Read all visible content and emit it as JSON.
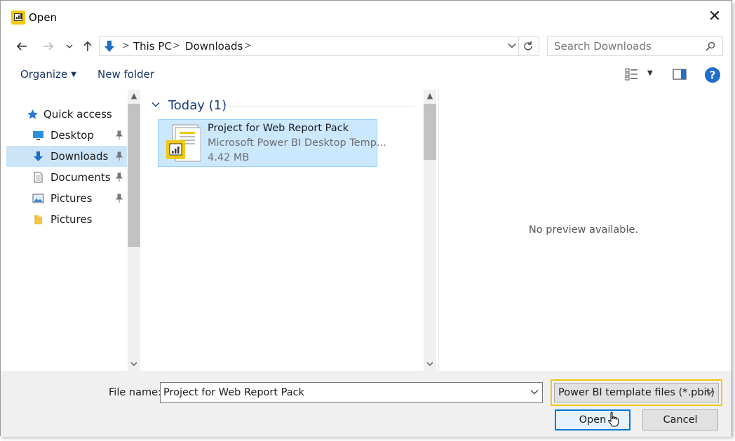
{
  "window": {
    "title": "Open",
    "close_icon": "close-icon"
  },
  "colors": {
    "accent": "#0078d7",
    "highlight": "#f2c811",
    "selection": "#cce8ff",
    "header_blue": "#1a3c7a"
  },
  "address_bar": {
    "crumbs": [
      "This PC",
      "Downloads"
    ],
    "separator": ">"
  },
  "search": {
    "placeholder": "Search Downloads"
  },
  "toolbar": {
    "organize_label": "Organize",
    "new_folder_label": "New folder",
    "help_label": "?"
  },
  "nav": {
    "items": [
      {
        "label": "Quick access",
        "icon": "star-icon",
        "pinned": false,
        "selected": false
      },
      {
        "label": "Desktop",
        "icon": "desktop-icon",
        "pinned": true,
        "selected": false
      },
      {
        "label": "Downloads",
        "icon": "download-icon",
        "pinned": true,
        "selected": true
      },
      {
        "label": "Documents",
        "icon": "document-icon",
        "pinned": true,
        "selected": false
      },
      {
        "label": "Pictures",
        "icon": "pictures-icon",
        "pinned": true,
        "selected": false
      },
      {
        "label": "Pictures",
        "icon": "folder-icon",
        "pinned": false,
        "selected": false
      }
    ]
  },
  "files": {
    "group_label": "Today (1)",
    "items": [
      {
        "name": "Project for Web Report Pack",
        "type": "Microsoft Power BI Desktop Temp...",
        "size": "4.42 MB"
      }
    ]
  },
  "preview": {
    "message": "No preview available."
  },
  "bottom": {
    "file_name_label": "File name:",
    "file_name_value": "Project for Web Report Pack",
    "filter_value": "Power BI template files (*.pbit)",
    "open_label": "Open",
    "cancel_label": "Cancel"
  }
}
